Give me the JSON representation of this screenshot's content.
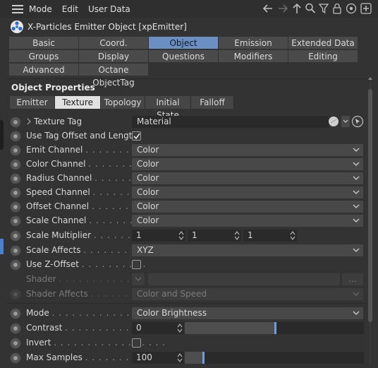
{
  "menu": {
    "items": [
      "Mode",
      "Edit",
      "User Data"
    ]
  },
  "title": {
    "text": "X-Particles Emitter Object [xpEmitter]"
  },
  "tabs": {
    "row1": [
      "Basic",
      "Coord.",
      "Object",
      "Emission",
      "Extended Data"
    ],
    "row2": [
      "Groups",
      "Display",
      "Questions",
      "Modifiers",
      "Editing"
    ],
    "row3": [
      "Advanced",
      "Octane ObjectTag"
    ],
    "active": "Object"
  },
  "section": {
    "title": "Object Properties"
  },
  "subtabs": {
    "items": [
      "Emitter",
      "Texture",
      "Topology",
      "Initial State",
      "Falloff"
    ],
    "active": "Texture"
  },
  "fields": {
    "texture_tag": {
      "label": "Texture Tag",
      "value": "Material"
    },
    "use_tag_offset": {
      "label": "Use Tag Offset and Length",
      "checked": true
    },
    "emit_channel": {
      "label": "Emit Channel",
      "dots": ". . . . . . . . . .",
      "value": "Color"
    },
    "color_channel": {
      "label": "Color Channel",
      "dots": ". . . . . . . . .",
      "value": "Color"
    },
    "radius_channel": {
      "label": "Radius Channel",
      "dots": ". . . . . . . .",
      "value": "Color"
    },
    "speed_channel": {
      "label": "Speed Channel",
      "dots": ". . . . . . . . .",
      "value": "Color"
    },
    "offset_channel": {
      "label": "Offset Channel",
      "dots": ". . . . . . . .",
      "value": "Color"
    },
    "scale_channel": {
      "label": "Scale Channel",
      "dots": ". . . . . . . . .",
      "value": "Color"
    },
    "scale_multiplier": {
      "label": "Scale Multiplier",
      "dots": ". . . . . . . .",
      "x": "1",
      "y": "1",
      "z": "1"
    },
    "scale_affects": {
      "label": "Scale Affects",
      "dots": ". . . . . . . . . .",
      "value": "XYZ"
    },
    "use_z_offset": {
      "label": "Use Z-Offset",
      "dots": ". . . . . . . . . .",
      "checked": false
    },
    "shader": {
      "label": "Shader",
      "dots": ". . . . . . . . . . . . . . ."
    },
    "shader_affects": {
      "label": "Shader Affects",
      "dots": ". . . . . . . . .",
      "value": "Color and Speed"
    },
    "mode": {
      "label": "Mode",
      "dots": ". . . . . . . . . . . . . . . . .",
      "value": "Color Brightness"
    },
    "contrast": {
      "label": "Contrast",
      "dots": ". . . . . . . . . . . . . .",
      "value": "0",
      "slider_fraction": 0.5
    },
    "invert": {
      "label": "Invert",
      "dots": ". . . . . . . . . . . . . . . . .",
      "checked": false
    },
    "max_samples": {
      "label": "Max Samples",
      "dots": ". . . . . . . . . . .",
      "value": "100",
      "slider_fraction": 0.1
    }
  },
  "colors": {
    "accent": "#6b8fc1",
    "background": "#333333",
    "slider_thumb": "#6c9fe0"
  }
}
